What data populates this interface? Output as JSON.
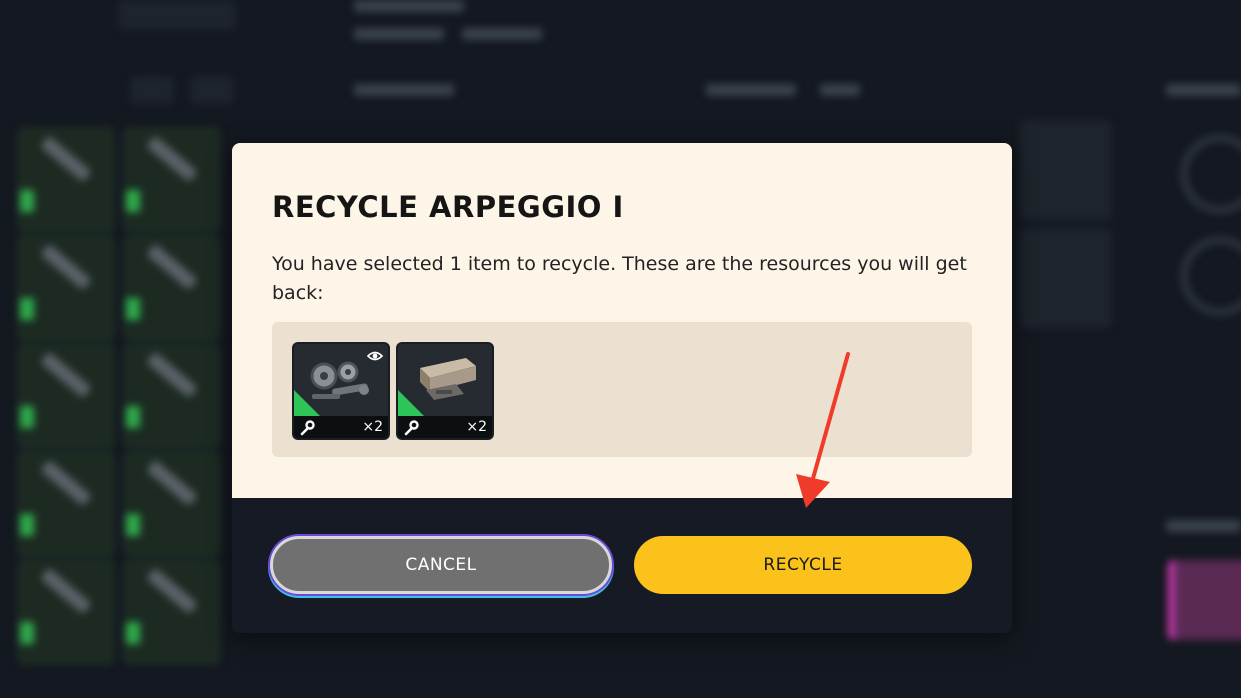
{
  "dialog": {
    "title": "RECYCLE ARPEGGIO I",
    "description": "You have selected 1 item to recycle. These are the resources you will get back:",
    "resources": [
      {
        "name": "mechanical-parts-icon",
        "count": "×2",
        "rarity_color": "#2dc458"
      },
      {
        "name": "metal-bar-icon",
        "count": "×2",
        "rarity_color": "#2dc458"
      }
    ],
    "cancel_label": "CANCEL",
    "recycle_label": "RECYCLE"
  },
  "colors": {
    "accent": "#fcc21c",
    "panel": "#fdf6e8",
    "annotation_arrow": "#f03a2a"
  }
}
